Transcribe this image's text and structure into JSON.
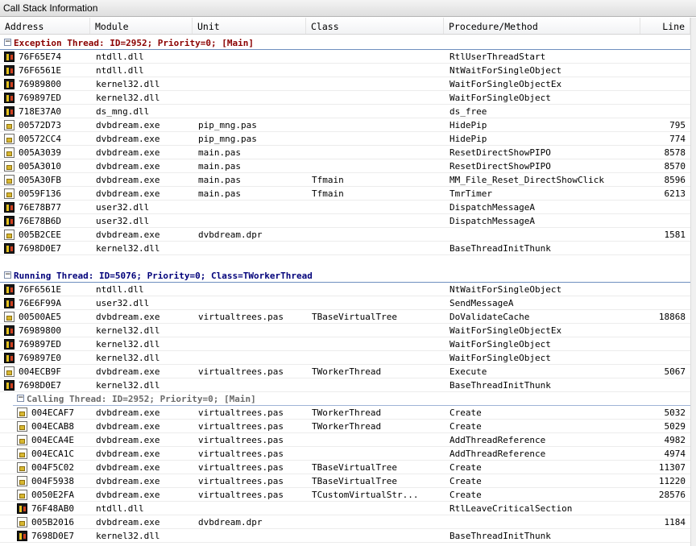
{
  "window": {
    "title": "Call Stack Information"
  },
  "columns": [
    "Address",
    "Module",
    "Unit",
    "Class",
    "Procedure/Method",
    "Line"
  ],
  "groups": [
    {
      "title": "Exception Thread: ID=2952; Priority=0; [Main]",
      "rows": [
        {
          "icon": "dll",
          "address": "76F65E74",
          "module": "ntdll.dll",
          "unit": "",
          "class": "",
          "procedure": "RtlUserThreadStart",
          "line": ""
        },
        {
          "icon": "dll",
          "address": "76F6561E",
          "module": "ntdll.dll",
          "unit": "",
          "class": "",
          "procedure": "NtWaitForSingleObject",
          "line": ""
        },
        {
          "icon": "dll",
          "address": "76989800",
          "module": "kernel32.dll",
          "unit": "",
          "class": "",
          "procedure": "WaitForSingleObjectEx",
          "line": ""
        },
        {
          "icon": "dll",
          "address": "769897ED",
          "module": "kernel32.dll",
          "unit": "",
          "class": "",
          "procedure": "WaitForSingleObject",
          "line": ""
        },
        {
          "icon": "dll",
          "address": "718E37A0",
          "module": "ds_mng.dll",
          "unit": "",
          "class": "",
          "procedure": "ds_free",
          "line": ""
        },
        {
          "icon": "exe",
          "address": "00572D73",
          "module": "dvbdream.exe",
          "unit": "pip_mng.pas",
          "class": "",
          "procedure": "HidePip",
          "line": "795"
        },
        {
          "icon": "exe",
          "address": "00572CC4",
          "module": "dvbdream.exe",
          "unit": "pip_mng.pas",
          "class": "",
          "procedure": "HidePip",
          "line": "774"
        },
        {
          "icon": "exe",
          "address": "005A3039",
          "module": "dvbdream.exe",
          "unit": "main.pas",
          "class": "",
          "procedure": "ResetDirectShowPIPO",
          "line": "8578"
        },
        {
          "icon": "exe",
          "address": "005A3010",
          "module": "dvbdream.exe",
          "unit": "main.pas",
          "class": "",
          "procedure": "ResetDirectShowPIPO",
          "line": "8570"
        },
        {
          "icon": "exe",
          "address": "005A30FB",
          "module": "dvbdream.exe",
          "unit": "main.pas",
          "class": "Tfmain",
          "procedure": "MM_File_Reset_DirectShowClick",
          "line": "8596"
        },
        {
          "icon": "exe",
          "address": "0059F136",
          "module": "dvbdream.exe",
          "unit": "main.pas",
          "class": "Tfmain",
          "procedure": "TmrTimer",
          "line": "6213"
        },
        {
          "icon": "dll",
          "address": "76E78B77",
          "module": "user32.dll",
          "unit": "",
          "class": "",
          "procedure": "DispatchMessageA",
          "line": ""
        },
        {
          "icon": "dll",
          "address": "76E78B6D",
          "module": "user32.dll",
          "unit": "",
          "class": "",
          "procedure": "DispatchMessageA",
          "line": ""
        },
        {
          "icon": "exe",
          "address": "005B2CEE",
          "module": "dvbdream.exe",
          "unit": "dvbdream.dpr",
          "class": "",
          "procedure": "",
          "line": "1581"
        },
        {
          "icon": "dll",
          "address": "7698D0E7",
          "module": "kernel32.dll",
          "unit": "",
          "class": "",
          "procedure": "BaseThreadInitThunk",
          "line": ""
        }
      ]
    },
    {
      "title": "Running Thread: ID=5076; Priority=0; Class=TWorkerThread",
      "rows": [
        {
          "icon": "dll",
          "address": "76F6561E",
          "module": "ntdll.dll",
          "unit": "",
          "class": "",
          "procedure": "NtWaitForSingleObject",
          "line": ""
        },
        {
          "icon": "dll",
          "address": "76E6F99A",
          "module": "user32.dll",
          "unit": "",
          "class": "",
          "procedure": "SendMessageA",
          "line": ""
        },
        {
          "icon": "exe",
          "address": "00500AE5",
          "module": "dvbdream.exe",
          "unit": "virtualtrees.pas",
          "class": "TBaseVirtualTree",
          "procedure": "DoValidateCache",
          "line": "18868"
        },
        {
          "icon": "dll",
          "address": "76989800",
          "module": "kernel32.dll",
          "unit": "",
          "class": "",
          "procedure": "WaitForSingleObjectEx",
          "line": ""
        },
        {
          "icon": "dll",
          "address": "769897ED",
          "module": "kernel32.dll",
          "unit": "",
          "class": "",
          "procedure": "WaitForSingleObject",
          "line": ""
        },
        {
          "icon": "dll",
          "address": "769897E0",
          "module": "kernel32.dll",
          "unit": "",
          "class": "",
          "procedure": "WaitForSingleObject",
          "line": ""
        },
        {
          "icon": "exe",
          "address": "004ECB9F",
          "module": "dvbdream.exe",
          "unit": "virtualtrees.pas",
          "class": "TWorkerThread",
          "procedure": "Execute",
          "line": "5067"
        },
        {
          "icon": "dll",
          "address": "7698D0E7",
          "module": "kernel32.dll",
          "unit": "",
          "class": "",
          "procedure": "BaseThreadInitThunk",
          "line": ""
        }
      ]
    },
    {
      "title": "Calling Thread: ID=2952; Priority=0; [Main]",
      "rows": [
        {
          "icon": "exe",
          "address": "004ECAF7",
          "module": "dvbdream.exe",
          "unit": "virtualtrees.pas",
          "class": "TWorkerThread",
          "procedure": "Create",
          "line": "5032"
        },
        {
          "icon": "exe",
          "address": "004ECAB8",
          "module": "dvbdream.exe",
          "unit": "virtualtrees.pas",
          "class": "TWorkerThread",
          "procedure": "Create",
          "line": "5029"
        },
        {
          "icon": "exe",
          "address": "004ECA4E",
          "module": "dvbdream.exe",
          "unit": "virtualtrees.pas",
          "class": "",
          "procedure": "AddThreadReference",
          "line": "4982"
        },
        {
          "icon": "exe",
          "address": "004ECA1C",
          "module": "dvbdream.exe",
          "unit": "virtualtrees.pas",
          "class": "",
          "procedure": "AddThreadReference",
          "line": "4974"
        },
        {
          "icon": "exe",
          "address": "004F5C02",
          "module": "dvbdream.exe",
          "unit": "virtualtrees.pas",
          "class": "TBaseVirtualTree",
          "procedure": "Create",
          "line": "11307"
        },
        {
          "icon": "exe",
          "address": "004F5938",
          "module": "dvbdream.exe",
          "unit": "virtualtrees.pas",
          "class": "TBaseVirtualTree",
          "procedure": "Create",
          "line": "11220"
        },
        {
          "icon": "exe",
          "address": "0050E2FA",
          "module": "dvbdream.exe",
          "unit": "virtualtrees.pas",
          "class": "TCustomVirtualStr...",
          "procedure": "Create",
          "line": "28576"
        },
        {
          "icon": "dll",
          "address": "76F48AB0",
          "module": "ntdll.dll",
          "unit": "",
          "class": "",
          "procedure": "RtlLeaveCriticalSection",
          "line": ""
        },
        {
          "icon": "exe",
          "address": "005B2016",
          "module": "dvbdream.exe",
          "unit": "dvbdream.dpr",
          "class": "",
          "procedure": "",
          "line": "1184"
        },
        {
          "icon": "dll",
          "address": "7698D0E7",
          "module": "kernel32.dll",
          "unit": "",
          "class": "",
          "procedure": "BaseThreadInitThunk",
          "line": ""
        }
      ]
    }
  ],
  "colors": {
    "exception_group": "#8b0000",
    "running_group": "#00007a",
    "calling_group": "#6a6a6a"
  },
  "icons": {
    "dll": "dll-module-icon",
    "exe": "exe-module-icon",
    "toggle": "collapse-minus-icon"
  }
}
